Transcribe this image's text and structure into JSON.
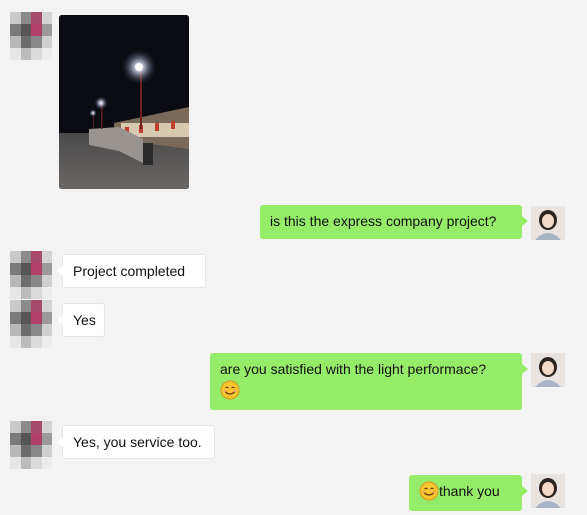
{
  "messages": {
    "m1": {
      "text": "is this the express company project?"
    },
    "m2": {
      "text": "Project completed"
    },
    "m3": {
      "text": "Yes"
    },
    "m4": {
      "text": "are you satisfied with the light performace?"
    },
    "m5": {
      "text": "Yes, you service too."
    },
    "m6": {
      "text": "thank you"
    }
  },
  "colors": {
    "background": "#f3f3f3",
    "incoming_bubble": "#ffffff",
    "outgoing_bubble": "#95ec69"
  }
}
